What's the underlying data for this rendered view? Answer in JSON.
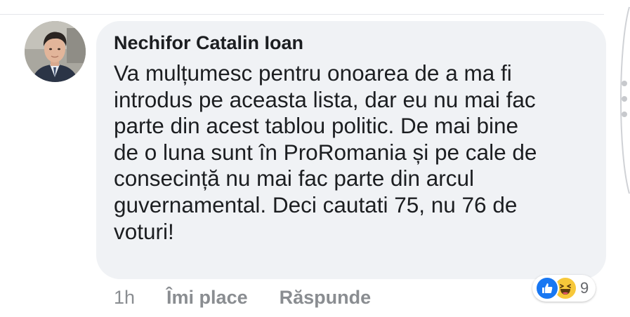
{
  "comment": {
    "author": "Nechifor Catalin Ioan",
    "text_lines": [
      "Va mulțumesc pentru onoarea de a ma fi",
      "introdus pe aceasta lista, dar eu nu mai fac",
      "parte din acest tablou politic. De mai bine",
      "de o luna sunt în ProRomania și pe cale de",
      "consecință nu mai fac parte din arcul",
      "guvernamental. Deci cautati 75, nu 76 de",
      "voturi!"
    ],
    "reactions": {
      "icons": [
        "like-icon",
        "haha-icon"
      ],
      "count": "9"
    }
  },
  "actions": {
    "timestamp": "1h",
    "like_label": "Îmi place",
    "reply_label": "Răspunde"
  },
  "colors": {
    "bubble": "#f0f2f5",
    "text": "#1c1e21",
    "muted": "#8a8d91",
    "like_blue": "#1877f2",
    "haha_yellow": "#f7c83a"
  }
}
